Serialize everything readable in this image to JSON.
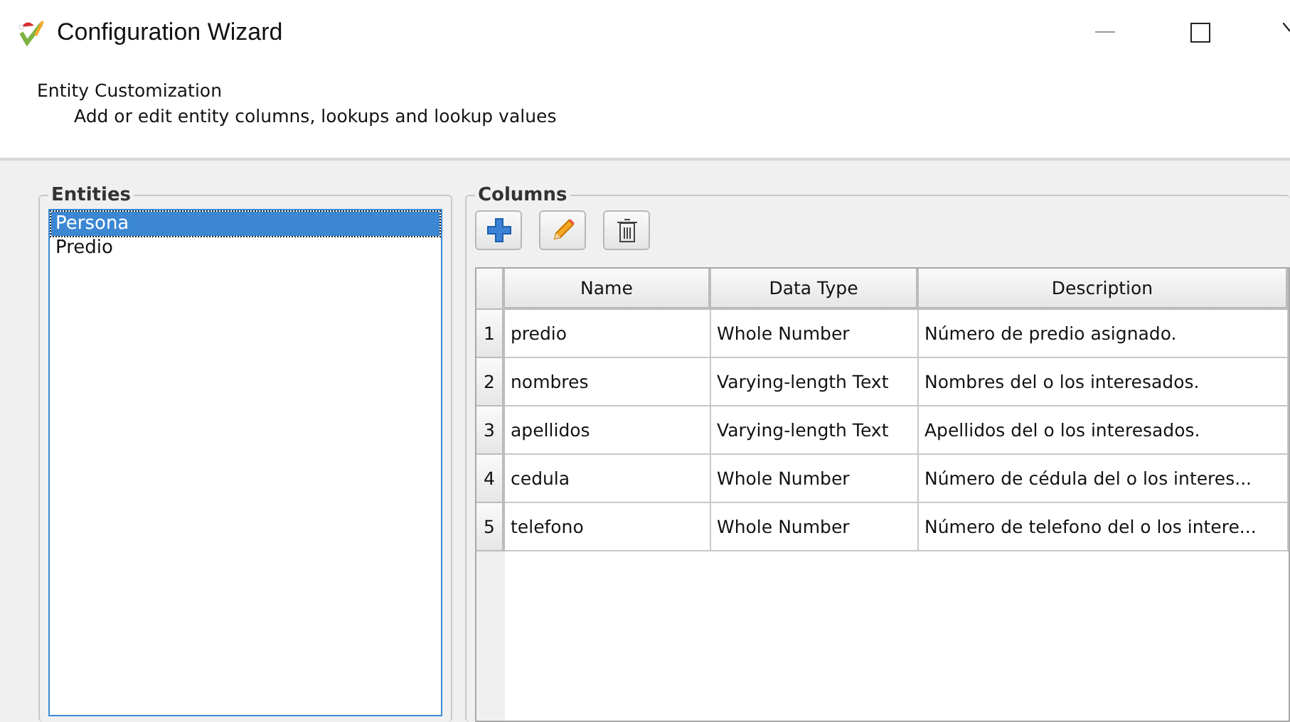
{
  "window": {
    "title": "Configuration Wizard"
  },
  "header": {
    "title": "Entity Customization",
    "subtitle": "Add or edit entity columns, lookups and lookup values"
  },
  "entities": {
    "title": "Entities",
    "items": [
      {
        "label": "Persona",
        "selected": true
      },
      {
        "label": "Predio",
        "selected": false
      }
    ]
  },
  "columns": {
    "title": "Columns",
    "table": {
      "columns": [
        "Name",
        "Data Type",
        "Description"
      ],
      "rows": [
        {
          "number": "1",
          "name": "predio",
          "data_type": "Whole Number",
          "description": "Número de predio asignado."
        },
        {
          "number": "2",
          "name": "nombres",
          "data_type": "Varying-length Text",
          "description": "Nombres del o los interesados."
        },
        {
          "number": "3",
          "name": "apellidos",
          "data_type": "Varying-length Text",
          "description": "Apellidos del o los interesados."
        },
        {
          "number": "4",
          "name": "cedula",
          "data_type": "Whole Number",
          "description": "Número de cédula del o los interes..."
        },
        {
          "number": "5",
          "name": "telefono",
          "data_type": "Whole Number",
          "description": "Número de telefono del o los intere..."
        }
      ]
    }
  }
}
